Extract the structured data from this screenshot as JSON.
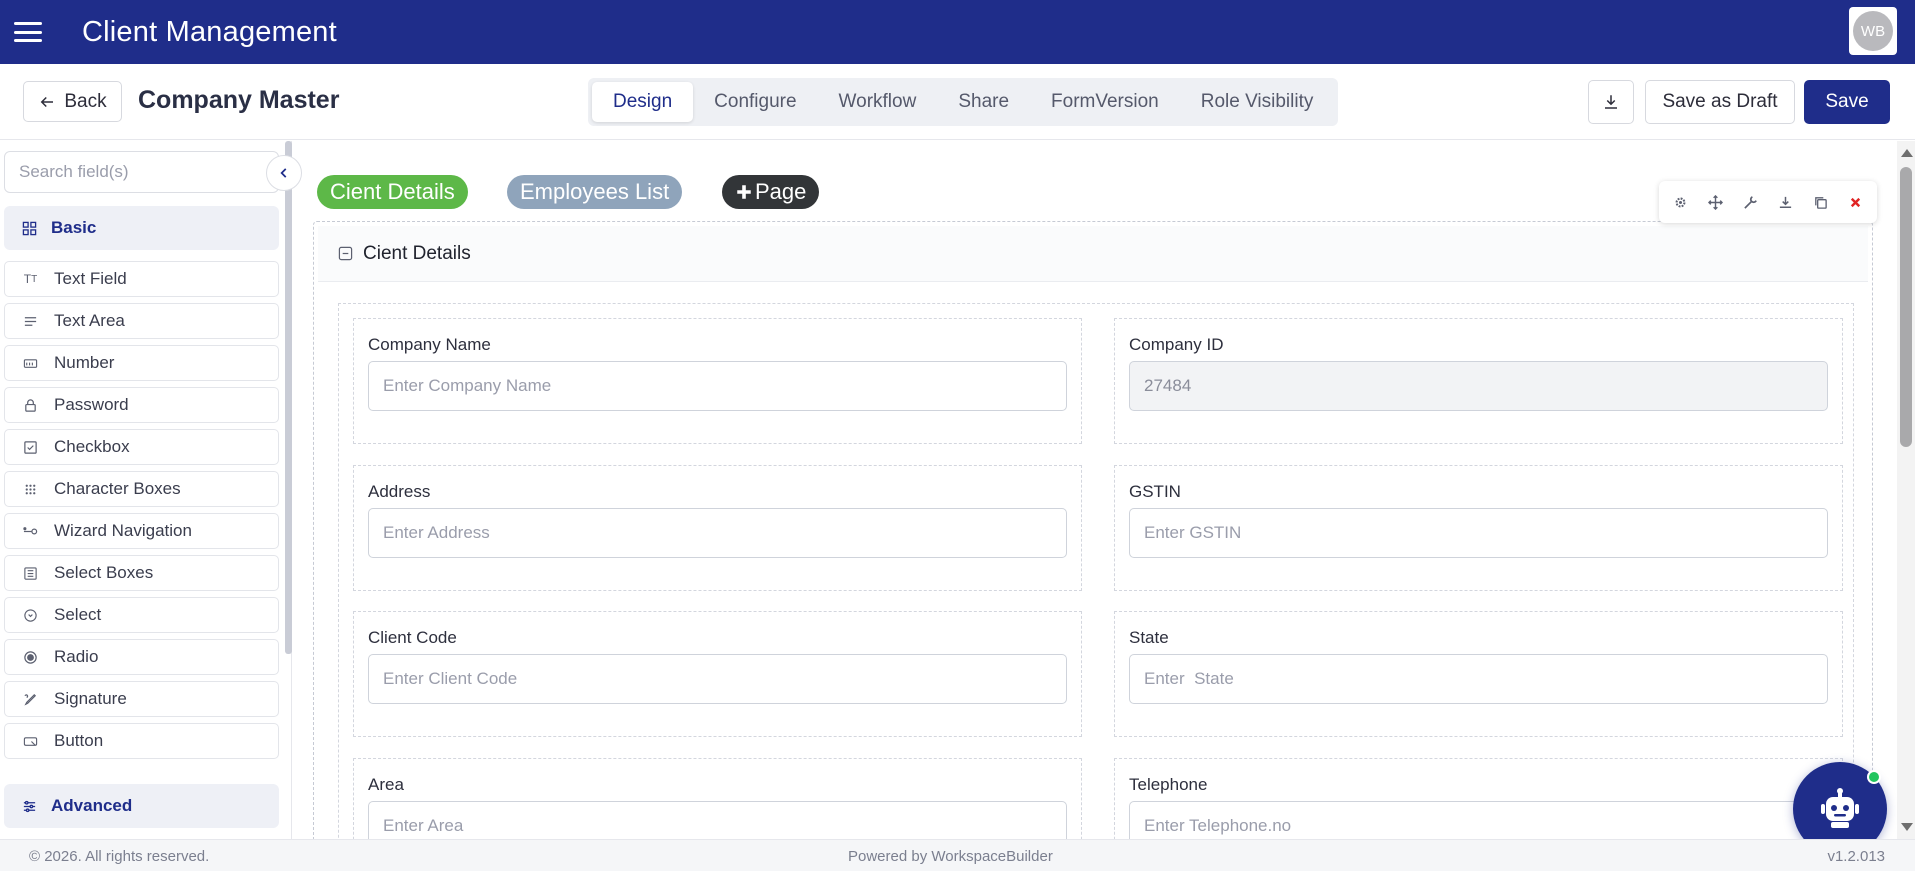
{
  "app": {
    "title": "Client Management",
    "avatar_initials": "WB",
    "brand_color": "#1f2d8a"
  },
  "header": {
    "back_label": "Back",
    "page_title": "Company Master",
    "tabs": [
      {
        "label": "Design",
        "active": true
      },
      {
        "label": "Configure",
        "active": false
      },
      {
        "label": "Workflow",
        "active": false
      },
      {
        "label": "Share",
        "active": false
      },
      {
        "label": "FormVersion",
        "active": false
      },
      {
        "label": "Role Visibility",
        "active": false
      }
    ],
    "download_icon": "download-icon",
    "save_draft_label": "Save as Draft",
    "save_label": "Save"
  },
  "sidebar": {
    "search_placeholder": "Search field(s)",
    "basic_label": "Basic",
    "advanced_label": "Advanced",
    "items": [
      {
        "label": "Text Field",
        "icon": "text-field-icon"
      },
      {
        "label": "Text Area",
        "icon": "text-area-icon"
      },
      {
        "label": "Number",
        "icon": "number-icon"
      },
      {
        "label": "Password",
        "icon": "lock-icon"
      },
      {
        "label": "Checkbox",
        "icon": "checkbox-icon"
      },
      {
        "label": "Character Boxes",
        "icon": "grid-dots-icon"
      },
      {
        "label": "Wizard Navigation",
        "icon": "wizard-icon"
      },
      {
        "label": "Select Boxes",
        "icon": "list-box-icon"
      },
      {
        "label": "Select",
        "icon": "circle-chevron-icon"
      },
      {
        "label": "Radio",
        "icon": "radio-icon"
      },
      {
        "label": "Signature",
        "icon": "pen-icon"
      },
      {
        "label": "Button",
        "icon": "button-icon"
      }
    ]
  },
  "canvas": {
    "pages": [
      {
        "label": "Cient Details",
        "color": "#5db848"
      },
      {
        "label": "Employees List",
        "color": "#8fa4bb"
      },
      {
        "label": "Page",
        "color": "#323538"
      }
    ],
    "panel_title": "Cient Details",
    "fields": [
      {
        "label": "Company Name",
        "placeholder": "Enter Company Name",
        "value": ""
      },
      {
        "label": "Company ID",
        "placeholder": "",
        "value": "27484"
      },
      {
        "label": "Address",
        "placeholder": "Enter Address",
        "value": ""
      },
      {
        "label": "GSTIN",
        "placeholder": "Enter GSTIN",
        "value": ""
      },
      {
        "label": "Client Code",
        "placeholder": "Enter Client Code",
        "value": ""
      },
      {
        "label": "State",
        "placeholder": "Enter  State",
        "value": ""
      },
      {
        "label": "Area",
        "placeholder": "Enter Area",
        "value": ""
      },
      {
        "label": "Telephone",
        "placeholder": "Enter Telephone.no",
        "value": ""
      }
    ]
  },
  "footer": {
    "copyright": "© 2026. All rights reserved.",
    "powered_by": "Powered by WorkspaceBuilder",
    "version": "v1.2.013"
  }
}
